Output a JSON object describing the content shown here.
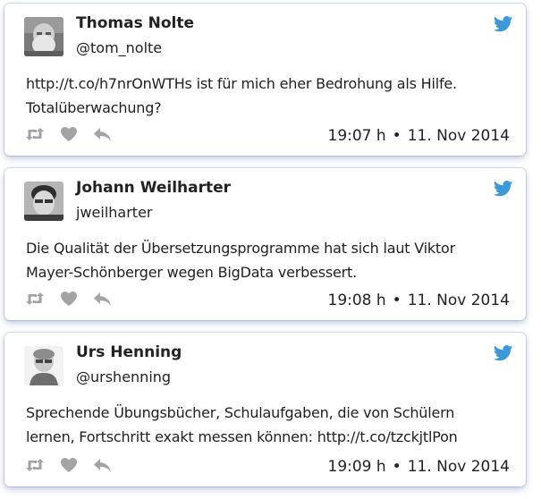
{
  "colors": {
    "twitter_blue": "#3b98d9",
    "action_gray": "#a3a3a3"
  },
  "icons": {
    "bird": "twitter-bird-icon",
    "retweet": "retweet-icon",
    "like": "heart-icon",
    "reply": "reply-icon"
  },
  "tweets": [
    {
      "name": "Thomas Nolte",
      "handle": "@tom_nolte",
      "text": "http://t.co/h7nrOnWTHs ist für mich eher Bedrohung als Hilfe. Totalüberwachung?",
      "time": "19:07 h",
      "separator": "•",
      "date": "11. Nov 2014"
    },
    {
      "name": "Johann Weilharter",
      "handle": "jweilharter",
      "text": "Die Qualität der Übersetzungsprogramme hat sich laut Viktor Mayer-Schönberger wegen BigData verbessert.",
      "time": "19:08 h",
      "separator": "•",
      "date": "11. Nov 2014"
    },
    {
      "name": "Urs Henning",
      "handle": "@urshenning",
      "text": "Sprechende Übungsbücher, Schulaufgaben, die von Schülern lernen, Fortschritt exakt messen können: http://t.co/tzckjtlPon",
      "time": "19:09 h",
      "separator": "•",
      "date": "11. Nov 2014"
    }
  ]
}
